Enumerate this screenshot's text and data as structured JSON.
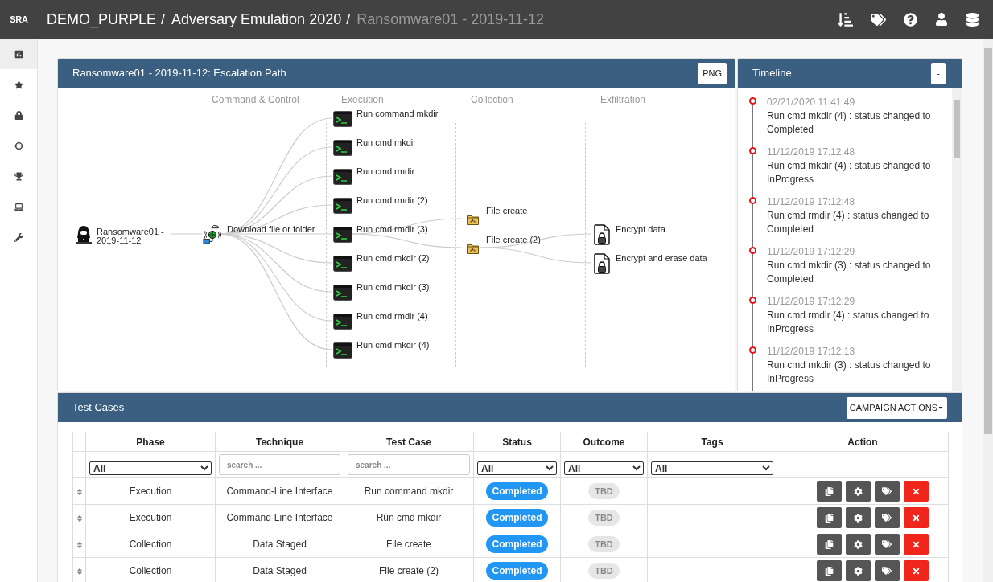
{
  "header": {
    "logo": "SRA",
    "separator": "/",
    "breadcrumbs": [
      {
        "label": "DEMO_PURPLE",
        "current": false
      },
      {
        "label": "Adversary Emulation 2020",
        "current": false
      },
      {
        "label": "Ransomware01 - 2019-11-12",
        "current": true
      }
    ]
  },
  "sidebar": {
    "items": [
      {
        "selected": true
      },
      {
        "selected": false
      },
      {
        "selected": false
      },
      {
        "selected": false
      },
      {
        "selected": false
      },
      {
        "selected": false
      },
      {
        "selected": false
      }
    ]
  },
  "escalation_path": {
    "title": "Ransomware01 - 2019-11-12: Escalation Path",
    "export_button": "PNG",
    "columns": [
      "Command & Control",
      "Execution",
      "Collection",
      "Exfiltration"
    ],
    "root": {
      "label": "Ransomware01 - 2019-11-12",
      "kind": "actor",
      "children": [
        {
          "label": "Download file or folder",
          "kind": "network",
          "children": [
            {
              "label": "Run command mkdir",
              "kind": "terminal"
            },
            {
              "label": "Run cmd mkdir",
              "kind": "terminal"
            },
            {
              "label": "Run cmd rmdir",
              "kind": "terminal"
            },
            {
              "label": "Run cmd rmdir (2)",
              "kind": "terminal"
            },
            {
              "label": "Run cmd rmdir (3)",
              "kind": "terminal",
              "children": [
                {
                  "label": "File create",
                  "kind": "folder"
                },
                {
                  "label": "File create (2)",
                  "kind": "folder",
                  "children": [
                    {
                      "label": "Encrypt data",
                      "kind": "locked-file"
                    },
                    {
                      "label": "Encrypt and erase data",
                      "kind": "locked-file"
                    }
                  ]
                }
              ]
            },
            {
              "label": "Run cmd mkdir (2)",
              "kind": "terminal"
            },
            {
              "label": "Run cmd mkdir (3)",
              "kind": "terminal"
            },
            {
              "label": "Run cmd rmdir (4)",
              "kind": "terminal"
            },
            {
              "label": "Run cmd mkdir (4)",
              "kind": "terminal"
            }
          ]
        }
      ]
    }
  },
  "timeline": {
    "title": "Timeline",
    "collapse_button": "-",
    "entries": [
      {
        "time": "02/21/2020 11:41:49",
        "text": "Run cmd mkdir (4) : status changed to Completed"
      },
      {
        "time": "11/12/2019 17:12:48",
        "text": "Run cmd mkdir (4) : status changed to InProgress"
      },
      {
        "time": "11/12/2019 17:12:48",
        "text": "Run cmd rmdir (4) : status changed to Completed"
      },
      {
        "time": "11/12/2019 17:12:29",
        "text": "Run cmd mkdir (3) : status changed to Completed"
      },
      {
        "time": "11/12/2019 17:12:29",
        "text": "Run cmd rmdir (4) : status changed to InProgress"
      },
      {
        "time": "11/12/2019 17:12:13",
        "text": "Run cmd mkdir (3) : status changed to InProgress"
      }
    ]
  },
  "test_cases": {
    "title": "Test Cases",
    "actions_button": "CAMPAIGN ACTIONS",
    "columns": [
      {
        "label": "Phase",
        "filter": {
          "kind": "select",
          "value": "All"
        }
      },
      {
        "label": "Technique",
        "filter": {
          "kind": "search",
          "placeholder": "search ..."
        }
      },
      {
        "label": "Test Case",
        "filter": {
          "kind": "search",
          "placeholder": "search ..."
        }
      },
      {
        "label": "Status",
        "filter": {
          "kind": "select",
          "value": "All"
        }
      },
      {
        "label": "Outcome",
        "filter": {
          "kind": "select",
          "value": "All"
        }
      },
      {
        "label": "Tags",
        "filter": {
          "kind": "select",
          "value": "All"
        }
      },
      {
        "label": "Action",
        "filter": {
          "kind": "none"
        }
      }
    ],
    "rows": [
      {
        "phase": "Execution",
        "technique": "Command-Line Interface",
        "test_case": "Run command mkdir",
        "status": "Completed",
        "outcome": "TBD"
      },
      {
        "phase": "Execution",
        "technique": "Command-Line Interface",
        "test_case": "Run cmd mkdir",
        "status": "Completed",
        "outcome": "TBD"
      },
      {
        "phase": "Collection",
        "technique": "Data Staged",
        "test_case": "File create",
        "status": "Completed",
        "outcome": "TBD"
      },
      {
        "phase": "Collection",
        "technique": "Data Staged",
        "test_case": "File create (2)",
        "status": "Completed",
        "outcome": "TBD"
      }
    ]
  }
}
